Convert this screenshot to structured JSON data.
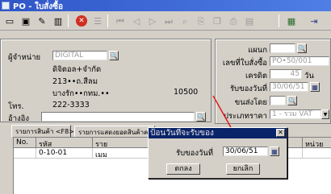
{
  "window": {
    "title": "PO - ใบสั่งซื้อ"
  },
  "toolbar": {
    "buttons": [
      {
        "icon": "new-doc-icon",
        "glyph": "▭"
      },
      {
        "icon": "save-icon",
        "glyph": "▣"
      },
      {
        "icon": "edit-icon",
        "glyph": "✎"
      },
      {
        "icon": "delete-icon",
        "glyph": "▥"
      },
      {
        "icon": "cancel-icon",
        "glyph": "✕"
      },
      {
        "icon": "list-icon",
        "glyph": "☰"
      },
      {
        "icon": "first-icon",
        "glyph": "⏮"
      },
      {
        "icon": "prev-icon",
        "glyph": "◁"
      },
      {
        "icon": "next-icon",
        "glyph": "▷"
      },
      {
        "icon": "last-icon",
        "glyph": "⏭"
      },
      {
        "icon": "find-icon",
        "glyph": "⌕"
      },
      {
        "icon": "attach-icon",
        "glyph": "⎘"
      },
      {
        "icon": "copy-icon",
        "glyph": "❐"
      },
      {
        "icon": "print-icon",
        "glyph": "⎙"
      },
      {
        "icon": "preview-icon",
        "glyph": "▤"
      },
      {
        "icon": "calc-icon",
        "glyph": "▦"
      },
      {
        "icon": "exit-icon",
        "glyph": "⇥"
      }
    ]
  },
  "supplier": {
    "label": "ผู้จำหน่าย",
    "code": "DIGITAL",
    "name": "ดิจิตอล+จำกัด",
    "address1": "213••ถ.สีลม",
    "address2": "บางรัก••กทม.••",
    "postcode": "10500",
    "tel_label": "โทร.",
    "tel": "222-3333",
    "ref_label": "อ้างอิง",
    "ref": ""
  },
  "doc": {
    "dept_label": "แผนก",
    "dept": "",
    "po_no_label": "เลขที่ใบสั่งซื้อ",
    "po_no": "PO•50/001",
    "credit_label": "เครดิต",
    "credit": "45",
    "credit_unit": "วัน",
    "receive_date_label": "รับของวันที่",
    "receive_date": "30/06/51",
    "ship_by_label": "ขนส่งโดย",
    "ship_by": "",
    "price_type_label": "ประเภทราคา",
    "price_type": "1 - รวม VAT"
  },
  "tabs": [
    {
      "label": "รายการสินค้า <F8>"
    },
    {
      "label": "รายการแสดงยอดสินค้าคงเหลือ"
    }
  ],
  "grid": {
    "headers": [
      "No.",
      "รหัส",
      "ราย",
      "หน่วย"
    ],
    "rows": [
      {
        "no": "",
        "code": "0-10-01",
        "desc": "เมม",
        "unit": ""
      }
    ]
  },
  "dialog": {
    "title": "ป้อนวันที่จะรับของ",
    "field_label": "รับของวันที่",
    "field_value": "30/06/51",
    "ok_label": "ตกลง",
    "cancel_label": "ยกเลิก"
  },
  "colors": {
    "titlebar": "#2f55c7",
    "dialog_titlebar": "#0a246a",
    "arrow": "#e01a1a"
  }
}
